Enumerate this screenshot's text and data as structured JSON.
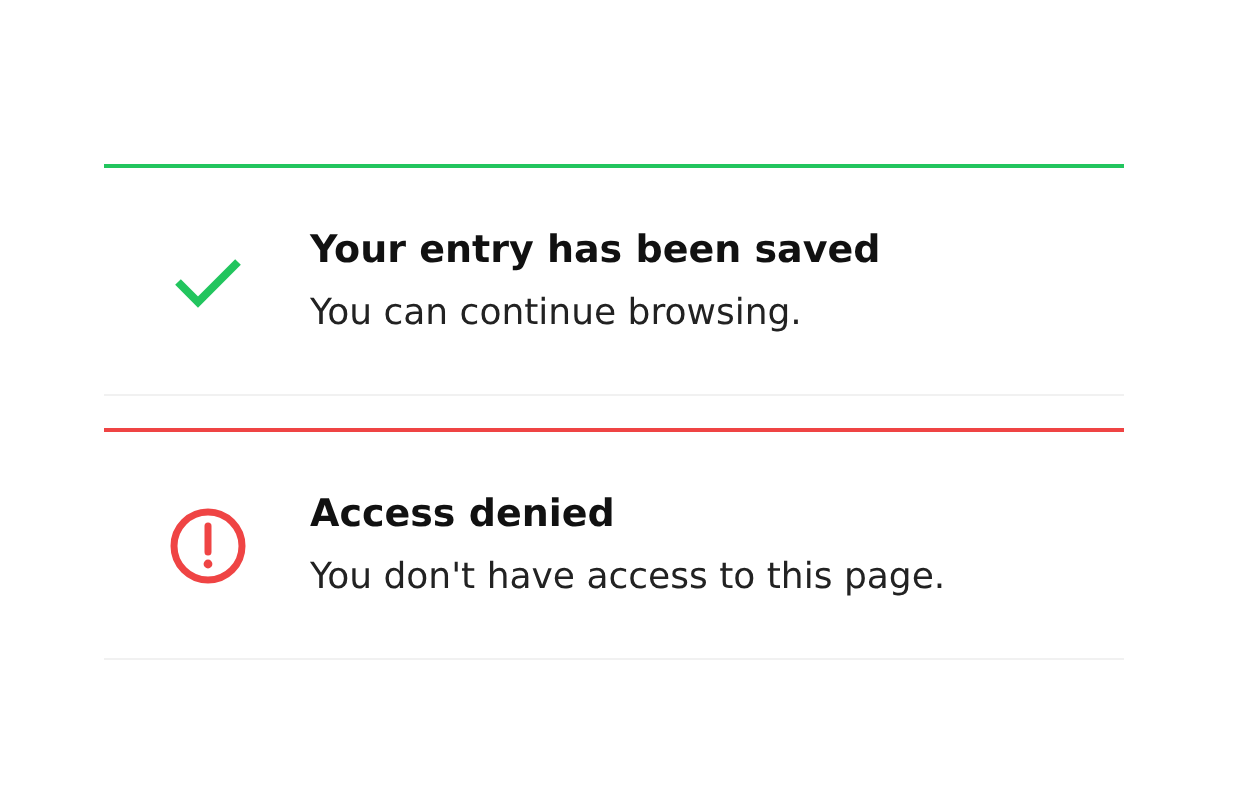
{
  "alerts": [
    {
      "kind": "success",
      "color": "#22c55e",
      "title": "Your entry has been saved",
      "message": "You can continue browsing."
    },
    {
      "kind": "error",
      "color": "#ef4444",
      "title": "Access denied",
      "message": "You don't have access to this page."
    }
  ]
}
